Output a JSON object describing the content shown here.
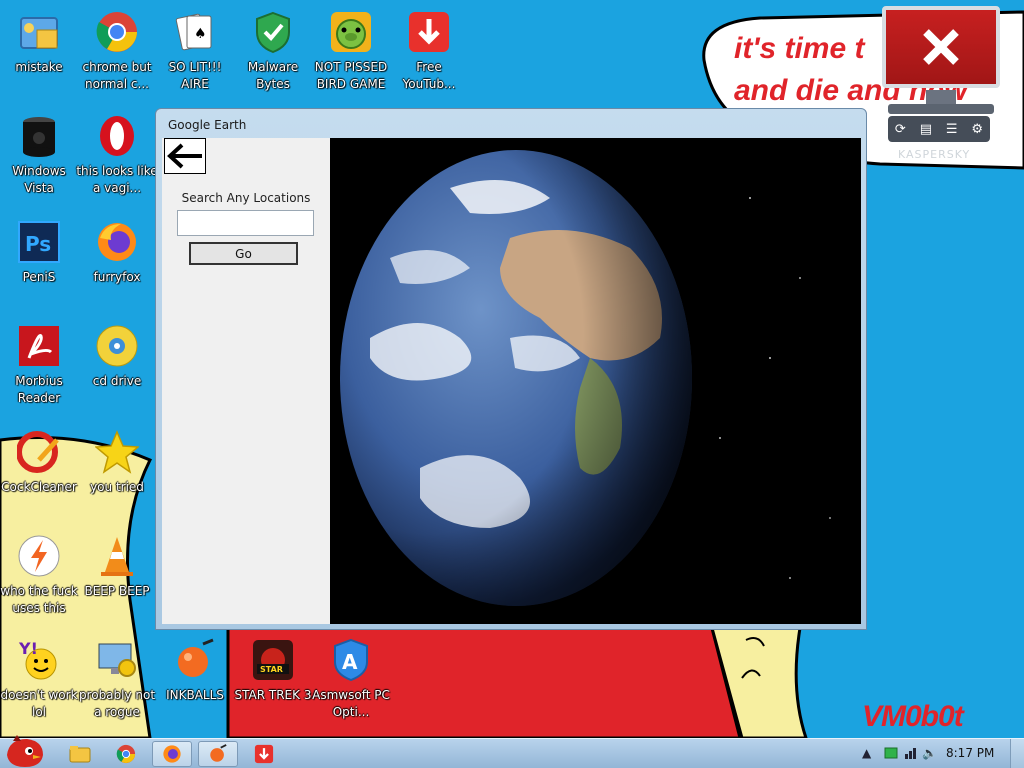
{
  "wallpaper": {
    "line1": "it's time t",
    "line2": "and die and new",
    "signature": "VM0b0t",
    "colors": {
      "sky": "#1ba3e0",
      "sand": "#f7efa0",
      "red": "#e0242a"
    }
  },
  "desktop_icons": [
    {
      "id": "mistake",
      "label": "mistake",
      "icon": "folder-check-icon"
    },
    {
      "id": "chrome",
      "label": "chrome but normal c...",
      "icon": "chrome-icon"
    },
    {
      "id": "solitaire",
      "label": "SO LIT!!! AIRE",
      "icon": "cards-icon"
    },
    {
      "id": "malwarebytes",
      "label": "Malware Bytes",
      "icon": "shield-check-icon"
    },
    {
      "id": "birdgame",
      "label": "NOT PISSED BIRD GAME",
      "icon": "green-pig-icon"
    },
    {
      "id": "youtube",
      "label": "Free YouTub...",
      "icon": "download-arrow-icon"
    },
    {
      "id": "vista",
      "label": "Windows Vista",
      "icon": "black-cylinder-icon"
    },
    {
      "id": "opera",
      "label": "this looks like a vagi...",
      "icon": "opera-icon"
    },
    {
      "id": "photoshop",
      "label": "PeniS",
      "icon": "photoshop-icon"
    },
    {
      "id": "firefox",
      "label": "furryfox",
      "icon": "firefox-icon"
    },
    {
      "id": "acrobat",
      "label": "Morbius Reader",
      "icon": "pdf-reader-icon"
    },
    {
      "id": "cddrive",
      "label": "cd drive",
      "icon": "cd-icon"
    },
    {
      "id": "ccleaner",
      "label": "CockCleaner",
      "icon": "ccleaner-icon"
    },
    {
      "id": "star",
      "label": "you tried",
      "icon": "star-icon"
    },
    {
      "id": "whothef",
      "label": "who the fuck uses this",
      "icon": "lightning-icon"
    },
    {
      "id": "vlc",
      "label": "BEEP BEEP",
      "icon": "traffic-cone-icon"
    },
    {
      "id": "yahoo",
      "label": "doesn't work lol",
      "icon": "yahoo-messenger-icon"
    },
    {
      "id": "rogue",
      "label": "probably not a rogue",
      "icon": "monitor-gears-icon"
    },
    {
      "id": "inkballs",
      "label": "INKBALLS",
      "icon": "ink-ball-icon"
    },
    {
      "id": "startrek",
      "label": "STAR TREK 3",
      "icon": "starwars-game-icon"
    },
    {
      "id": "asmwsoft",
      "label": "Asmwsoft PC Opti...",
      "icon": "asmwsoft-icon"
    }
  ],
  "kaspersky": {
    "brand": "KASPERSKY"
  },
  "window": {
    "title": "Google Earth",
    "search_label": "Search Any Locations",
    "search_value": "",
    "go_label": "Go"
  },
  "taskbar": {
    "time": "8:17 PM",
    "pinned": [
      "explorer-icon",
      "chrome-icon",
      "firefox-icon",
      "inkball-icon",
      "youtube-downloader-icon"
    ]
  }
}
